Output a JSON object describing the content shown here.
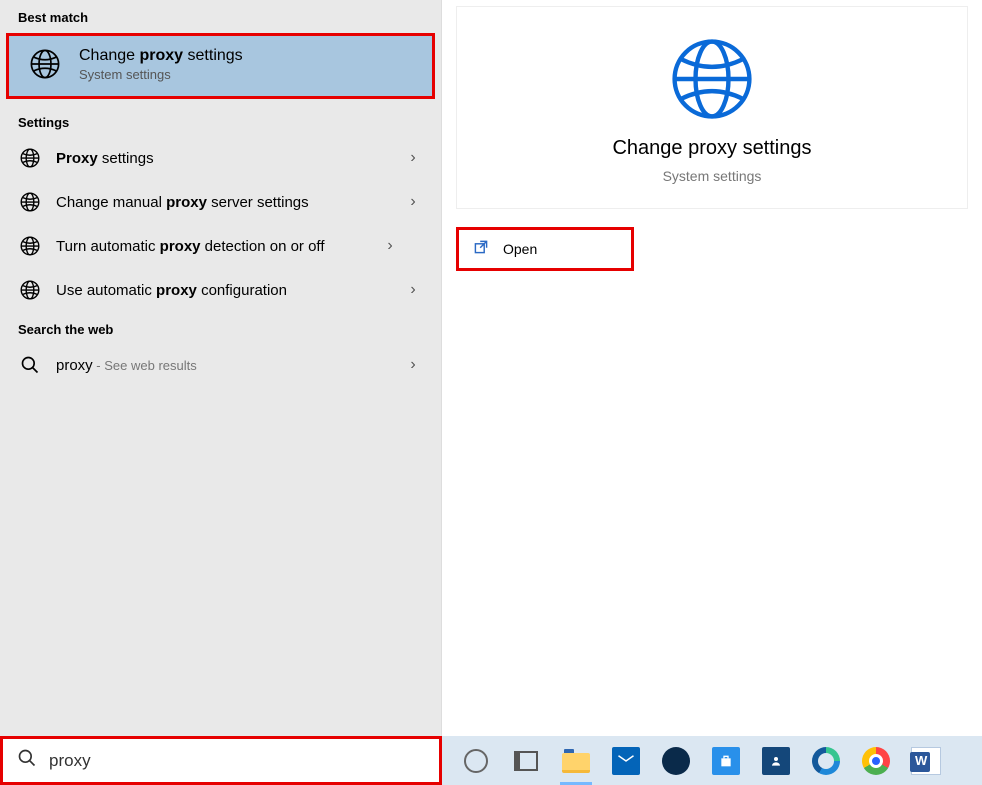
{
  "sections": {
    "best_match_header": "Best match",
    "settings_header": "Settings",
    "search_web_header": "Search the web"
  },
  "best_match": {
    "title_pre": "Change ",
    "title_bold": "proxy",
    "title_post": " settings",
    "subtitle": "System settings"
  },
  "settings_items": [
    {
      "pre": "",
      "bold": "Proxy",
      "post": " settings"
    },
    {
      "pre": "Change manual ",
      "bold": "proxy",
      "post": " server settings"
    },
    {
      "pre": "Turn automatic ",
      "bold": "proxy",
      "post": " detection on or off"
    },
    {
      "pre": "Use automatic ",
      "bold": "proxy",
      "post": " configuration"
    }
  ],
  "web_item": {
    "term": "proxy",
    "suffix": " - See web results"
  },
  "detail": {
    "title": "Change proxy settings",
    "subtitle": "System settings",
    "open_label": "Open"
  },
  "search": {
    "value": "proxy"
  },
  "taskbar": {
    "icons": [
      "cortana",
      "task-view",
      "file-explorer",
      "mail",
      "dell",
      "store",
      "contacts",
      "edge",
      "chrome",
      "word"
    ]
  },
  "colors": {
    "highlight_border": "#e60000",
    "selection_bg": "#a8c6df",
    "accent_blue": "#0a6ad8"
  }
}
